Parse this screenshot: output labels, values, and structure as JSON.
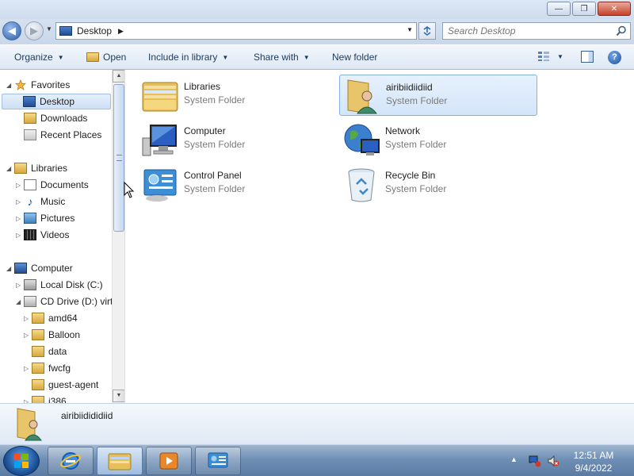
{
  "window": {
    "controls": {
      "minimize": "—",
      "restore": "❐",
      "close": "✕"
    }
  },
  "address": {
    "location": "Desktop",
    "search_placeholder": "Search Desktop"
  },
  "toolbar": {
    "organize": "Organize",
    "open": "Open",
    "include_in_library": "Include in library",
    "share_with": "Share with",
    "new_folder": "New folder"
  },
  "nav": {
    "favorites": "Favorites",
    "desktop": "Desktop",
    "downloads": "Downloads",
    "recent_places": "Recent Places",
    "libraries": "Libraries",
    "documents": "Documents",
    "music": "Music",
    "pictures": "Pictures",
    "videos": "Videos",
    "computer": "Computer",
    "local_disk": "Local Disk (C:)",
    "cd_drive": "CD Drive (D:) virt",
    "amd64": "amd64",
    "balloon": "Balloon",
    "data": "data",
    "fwcfg": "fwcfg",
    "guest_agent": "guest-agent",
    "i386": "i386"
  },
  "items": [
    {
      "name": "Libraries",
      "type": "System Folder"
    },
    {
      "name": "airibiidiidiid",
      "type": "System Folder"
    },
    {
      "name": "Computer",
      "type": "System Folder"
    },
    {
      "name": "Network",
      "type": "System Folder"
    },
    {
      "name": "Control Panel",
      "type": "System Folder"
    },
    {
      "name": "Recycle Bin",
      "type": "System Folder"
    }
  ],
  "details": {
    "selected_name": "airibiidididiid"
  },
  "clock": {
    "time": "12:51 AM",
    "date": "9/4/2022"
  },
  "colors": {
    "accent": "#2a5aa6",
    "selection": "#cde0f7",
    "taskbar": "#6f8fb5"
  }
}
